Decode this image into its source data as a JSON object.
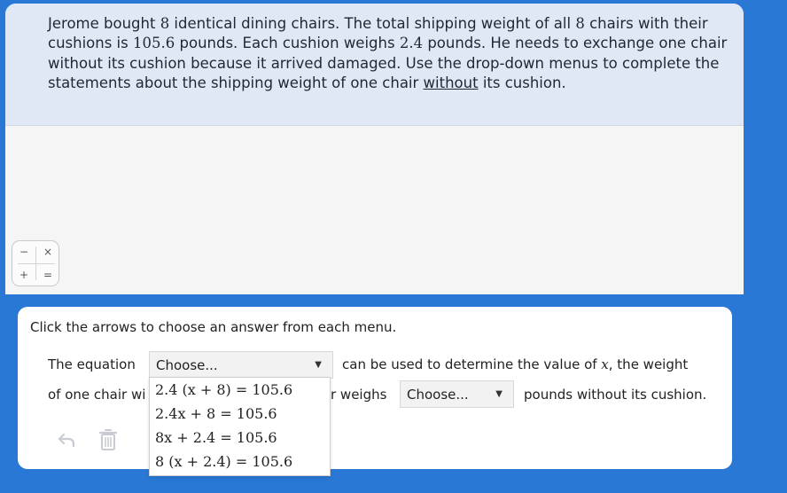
{
  "question": {
    "p1": "Jerome bought ",
    "n1": "8",
    "p2": " identical dining chairs. The total shipping weight of all ",
    "n2": "8",
    "p3": " chairs with their cushions is ",
    "n3": "105.6",
    "p4": " pounds. Each cushion weighs ",
    "n4": "2.4",
    "p5": " pounds. He needs to exchange one chair without its cushion because it arrived damaged. Use the drop-down menus to complete the statements about the shipping weight of one chair ",
    "underlined": "without",
    "p6": " its cushion."
  },
  "calculator": {
    "minus": "−",
    "times": "×",
    "plus": "+",
    "equals": "="
  },
  "panel": {
    "instruction": "Click the arrows to choose an answer from each menu.",
    "s1_before": "The equation",
    "dropdown1_value": "Choose...",
    "s1_after_a": "can be used to determine the value of ",
    "s1_var": "x",
    "s1_after_b": ", the weight",
    "s2_before_visible": "of one chair wi",
    "s2_mid_visible": "r weighs",
    "dropdown2_value": "Choose...",
    "s2_after": "pounds without its cushion."
  },
  "dropdown_options": [
    "2.4 (x + 8) = 105.6",
    "2.4x + 8 = 105.6",
    "8x + 2.4 = 105.6",
    "8 (x + 2.4) = 105.6"
  ],
  "tools": {
    "undo": "undo-icon",
    "delete": "trash-icon"
  },
  "colors": {
    "background": "#2a78d6",
    "question_bg": "#dfe8f4"
  }
}
